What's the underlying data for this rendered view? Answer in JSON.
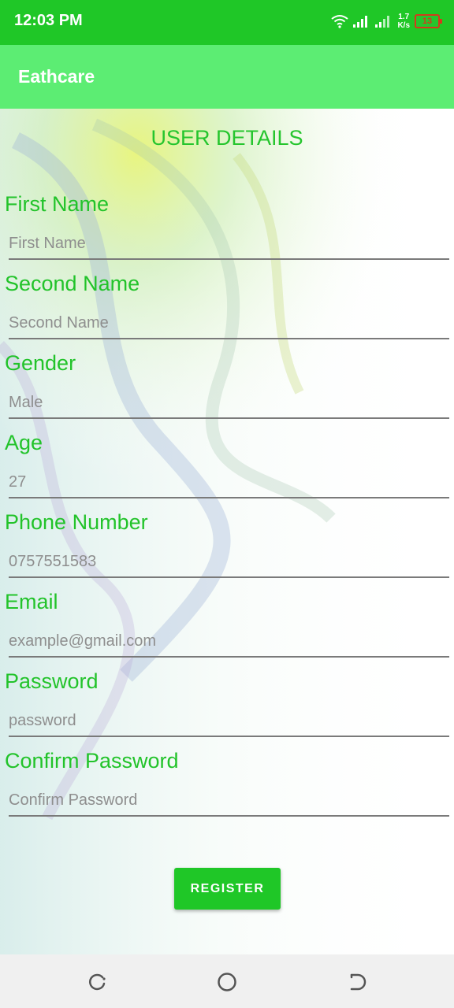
{
  "status_bar": {
    "time": "12:03 PM",
    "speed_value": "1.7",
    "speed_unit": "K/s",
    "battery": "13"
  },
  "app_bar": {
    "title": "Eathcare"
  },
  "form": {
    "title": "USER DETAILS",
    "fields": [
      {
        "label": "First Name",
        "placeholder": "First Name"
      },
      {
        "label": "Second Name",
        "placeholder": "Second Name"
      },
      {
        "label": "Gender",
        "placeholder": "Male"
      },
      {
        "label": "Age",
        "placeholder": "27"
      },
      {
        "label": "Phone Number",
        "placeholder": "0757551583"
      },
      {
        "label": "Email",
        "placeholder": "example@gmail.com"
      },
      {
        "label": "Password",
        "placeholder": "password"
      },
      {
        "label": "Confirm Password",
        "placeholder": "Confirm Password"
      }
    ],
    "register_label": "REGISTER"
  },
  "nav_bar": {
    "icons": [
      "recent-apps-icon",
      "home-icon",
      "back-icon"
    ]
  },
  "colors": {
    "status_bar": "#1fc727",
    "app_bar": "#5ced73",
    "accent_text": "#22c32a",
    "button": "#1fc727"
  }
}
